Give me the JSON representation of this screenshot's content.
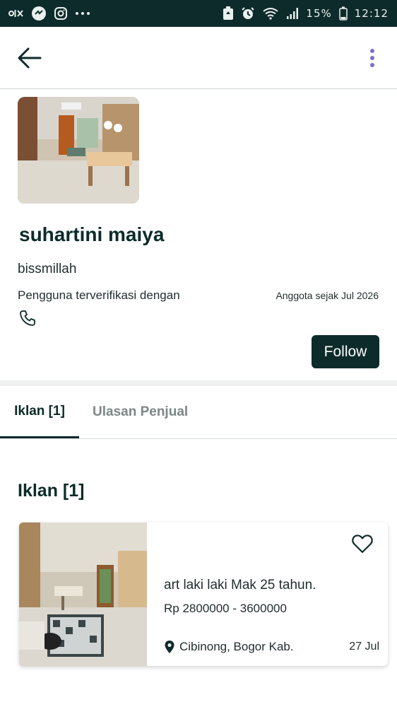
{
  "status_bar": {
    "battery_text": "15%",
    "time": "12:12",
    "left_icons": [
      "olx-icon",
      "cloud-app-icon",
      "instagram-icon",
      "more-dots-icon"
    ]
  },
  "app_bar": {
    "back_icon": "arrow-left-icon",
    "menu_icon": "kebab-menu-icon"
  },
  "profile": {
    "name": "suhartini maiya",
    "bio": "bissmillah",
    "verified_label": "Pengguna terverifikasi dengan",
    "member_since": "Anggota sejak Jul 2026",
    "follow_label": "Follow"
  },
  "tabs": [
    {
      "label": "Iklan [1]",
      "active": true
    },
    {
      "label": "Ulasan Penjual",
      "active": false
    }
  ],
  "section": {
    "title": "Iklan [1]"
  },
  "listing": {
    "title": "art  laki laki Mak 25 tahun.",
    "price": "Rp 2800000 - 3600000",
    "location": "Cibinong, Bogor Kab.",
    "date": "27 Jul"
  },
  "colors": {
    "primary": "#0d2b2a",
    "status_bar": "#0d2b2a",
    "muted_text": "#7b8786"
  }
}
